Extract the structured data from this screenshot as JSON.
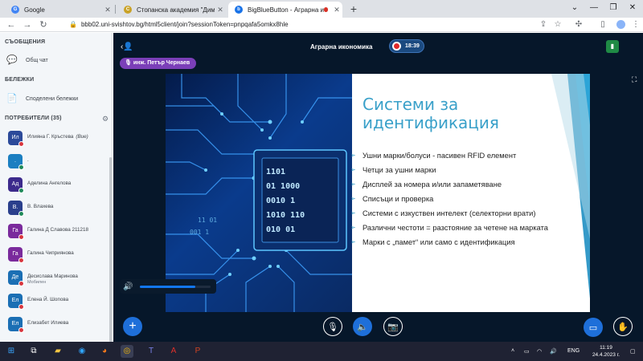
{
  "browser": {
    "tabs": [
      {
        "label": "Google",
        "active": false,
        "favicon": "google-icon"
      },
      {
        "label": "Стопанска академия \"Димитър",
        "active": false,
        "favicon": "academy-icon"
      },
      {
        "label": "BigBlueButton - Аграрна ико",
        "active": true,
        "favicon": "bbb-icon"
      }
    ],
    "url": "bbb02.uni-svishtov.bg/html5client/join?sessionToken=pnpqafa5omkx8hle"
  },
  "sidebar": {
    "messages_title": "СЪОБЩЕНИЯ",
    "public_chat": "Общ чат",
    "notes_title": "БЕЛЕЖКИ",
    "shared_notes": "Споделени бележки",
    "users_title": "ПОТРЕБИТЕЛИ (35)",
    "users": [
      {
        "initials": "Ил",
        "name": "Илияна Г. Кръстева",
        "suffix": "(Вие)",
        "sub": "",
        "color": "#2c4a9a",
        "badge": "#d9363e"
      },
      {
        "initials": ".",
        "name": ".",
        "suffix": "",
        "sub": "",
        "color": "#1b7fc1",
        "badge": "#1f8a5a"
      },
      {
        "initials": "Ад",
        "name": "Аделина Ангелова",
        "suffix": "",
        "sub": "",
        "color": "#3c2a8c",
        "badge": "#1f8a5a"
      },
      {
        "initials": "В.",
        "name": "В. Влахева",
        "suffix": "",
        "sub": "",
        "color": "#2a3f8c",
        "badge": "#1f8a5a"
      },
      {
        "initials": "Га",
        "name": "Галина Д Славова 211218",
        "suffix": "",
        "sub": "",
        "color": "#7a2a9c",
        "badge": "#d9363e"
      },
      {
        "initials": "Га",
        "name": "Галина Чиприянова",
        "suffix": "",
        "sub": "",
        "color": "#7a2a9c",
        "badge": "#d9363e"
      },
      {
        "initials": "Де",
        "name": "Десислава Маринова",
        "suffix": "",
        "sub": "Мобилен",
        "color": "#1b6fb4",
        "badge": "#d9363e"
      },
      {
        "initials": "Ел",
        "name": "Елена Й. Шопова",
        "suffix": "",
        "sub": "",
        "color": "#1b6fb4",
        "badge": "#d9363e"
      },
      {
        "initials": "Ел",
        "name": "Елизабет Илиева",
        "suffix": "",
        "sub": "",
        "color": "#1b6fb4",
        "badge": "#d9363e"
      }
    ]
  },
  "main": {
    "session_title": "Аграрна икономика",
    "recording_time": "18:39",
    "talker": "инж. Петър Чернаев",
    "volume_level": 0.78
  },
  "slide": {
    "title": "Системи за идентификация",
    "bullets": [
      "Ушни марки/болуси - пасивен RFID елемент",
      "Четци за ушни марки",
      "Дисплей за номера и/или запаметяване",
      "Списъци и проверка",
      "Системи с изкуствен интелект (селекторни врати)",
      "Различни честоти = разстояние за четене на марката",
      "Марки с „памет“ или само с идентификация"
    ]
  },
  "taskbar": {
    "language": "ENG",
    "time": "11:19",
    "date": "24.4.2023 г."
  }
}
